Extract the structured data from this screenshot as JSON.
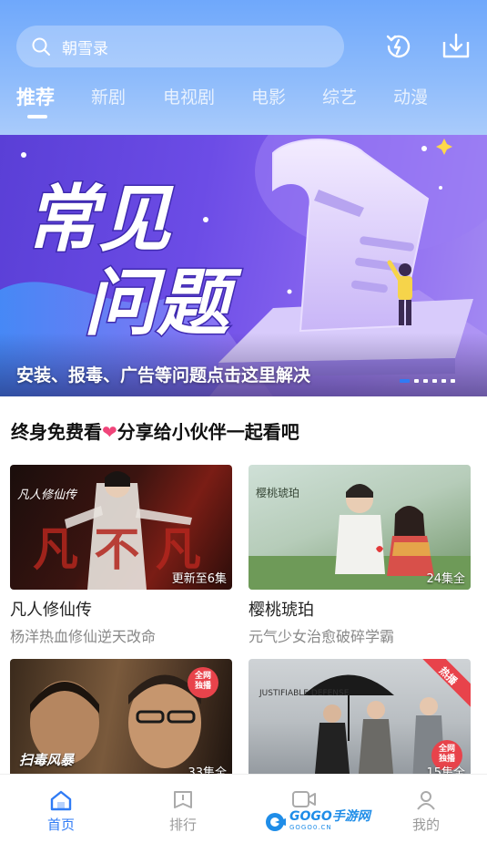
{
  "header": {
    "search_text": "朝雪录",
    "tabs": [
      {
        "label": "推荐",
        "active": true
      },
      {
        "label": "新剧",
        "active": false
      },
      {
        "label": "电视剧",
        "active": false
      },
      {
        "label": "电影",
        "active": false
      },
      {
        "label": "综艺",
        "active": false
      },
      {
        "label": "动漫",
        "active": false
      }
    ],
    "icons": [
      "history-icon",
      "download-icon"
    ]
  },
  "banner": {
    "line1": "常见",
    "line2": "问题",
    "caption": "安装、报毒、广告等问题点击这里解决",
    "slide_count": 6,
    "active_slide": 1
  },
  "section": {
    "title_part1": "终身免费看",
    "heart": "❤",
    "title_part2": "分享给小伙伴一起看吧"
  },
  "cards": [
    {
      "title": "凡人修仙传",
      "subtitle": "杨洋热血修仙逆天改命",
      "badge": "更新至6集",
      "poster_text": "凡人修仙传",
      "poster_art": "凡 不 凡"
    },
    {
      "title": "樱桃琥珀",
      "subtitle": "元气少女治愈破碎学霸",
      "badge": "24集全",
      "poster_text": "樱桃琥珀"
    },
    {
      "title": "",
      "subtitle": "",
      "badge": "33集全",
      "poster_text": "扫毒风暴",
      "corner_tag": "全网\n独播"
    },
    {
      "title": "",
      "subtitle": "",
      "badge": "15集全",
      "poster_text": "JUSTIFIABLE DEFENSE",
      "corner_tag": "全网\n独播",
      "ribbon": "热播"
    }
  ],
  "bottom_nav": [
    {
      "label": "首页",
      "icon": "home-icon",
      "active": true
    },
    {
      "label": "排行",
      "icon": "ranking-icon",
      "active": false
    },
    {
      "label": "",
      "icon": "video-icon",
      "active": false
    },
    {
      "label": "我的",
      "icon": "user-icon",
      "active": false
    }
  ],
  "watermark": {
    "text": "GOGO手游网",
    "sub": "GOGO0.CN"
  },
  "colors": {
    "accent": "#2f7bf5",
    "header_top": "#6fa8fb",
    "banner": "#6c4ce6",
    "heart": "#f0457a"
  }
}
